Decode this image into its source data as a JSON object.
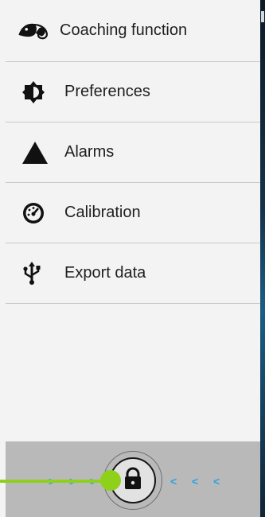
{
  "menu": {
    "items": [
      {
        "label": "Coaching function",
        "icon": "chameleon-icon"
      },
      {
        "label": "Preferences",
        "icon": "brightness-icon"
      },
      {
        "label": "Alarms",
        "icon": "warning-triangle-icon"
      },
      {
        "label": "Calibration",
        "icon": "gauge-icon"
      },
      {
        "label": "Export data",
        "icon": "usb-icon"
      }
    ]
  },
  "lock_slider": {
    "icon": "lock-icon",
    "left_arrows": ">>>",
    "right_arrows": "<<<",
    "accent_color": "#8fd11a",
    "arrow_color": "#2aa3e0"
  }
}
